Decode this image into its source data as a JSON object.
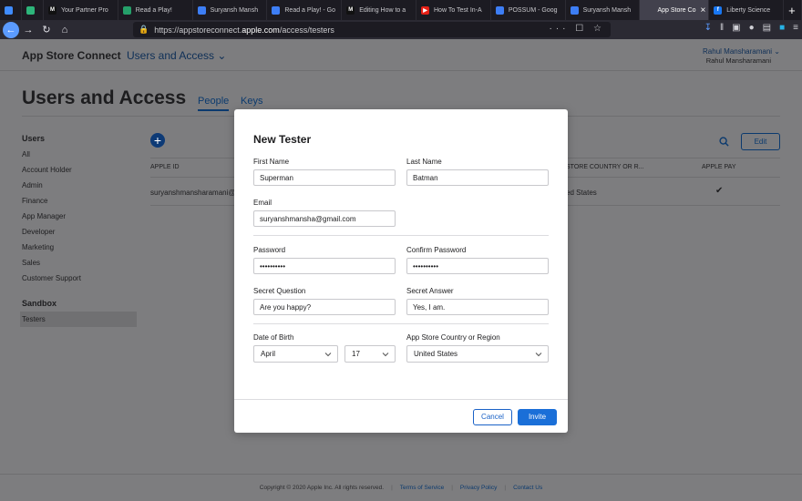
{
  "browser": {
    "tabs": [
      {
        "title": "",
        "icon": "infinity-icon",
        "color": "#3f8cff"
      },
      {
        "title": "",
        "icon": "shield-icon",
        "color": "#2db57a"
      },
      {
        "title": "Your Partner Pro",
        "icon": "medium-icon",
        "color": "#111111",
        "glyph": "M"
      },
      {
        "title": "Read a Play!",
        "icon": "image-icon",
        "color": "#25a06a",
        "glyph": ""
      },
      {
        "title": "Suryansh Mansh",
        "icon": "doc-icon",
        "color": "#3d7ef5",
        "glyph": ""
      },
      {
        "title": "Read a Play! - Go",
        "icon": "doc-icon",
        "color": "#3d7ef5",
        "glyph": ""
      },
      {
        "title": "Editing How to a",
        "icon": "medium-icon",
        "color": "#111111",
        "glyph": "M"
      },
      {
        "title": "How To Test In-A",
        "icon": "youtube-icon",
        "color": "#e62117",
        "glyph": "▶"
      },
      {
        "title": "POSSUM - Goog",
        "icon": "doc-icon",
        "color": "#3d7ef5",
        "glyph": ""
      },
      {
        "title": "Suryansh Mansh",
        "icon": "doc-icon",
        "color": "#3d7ef5",
        "glyph": ""
      },
      {
        "title": "App Store Co",
        "icon": "apple-icon",
        "color": "#42414d",
        "glyph": "",
        "active": true
      },
      {
        "title": "Liberty Science",
        "icon": "facebook-icon",
        "color": "#1877f2",
        "glyph": "f"
      }
    ],
    "url_prefix": "https://appstoreconnect.",
    "url_host": "apple.com",
    "url_path": "/access/testers",
    "url_right": "··· ☐ ☆"
  },
  "header": {
    "app_title": "App Store Connect",
    "section": "Users and Access ⌄",
    "user_name": "Rahul Mansharamani ⌄",
    "user_sub": "Rahul Mansharamani"
  },
  "page": {
    "title": "Users and Access",
    "tab_people": "People",
    "tab_keys": "Keys"
  },
  "sidebar": {
    "users_heading": "Users",
    "users_items": [
      "All",
      "Account Holder",
      "Admin",
      "Finance",
      "App Manager",
      "Developer",
      "Marketing",
      "Sales",
      "Customer Support"
    ],
    "sandbox_heading": "Sandbox",
    "sandbox_items": [
      "Testers"
    ]
  },
  "table": {
    "add_label": "+",
    "edit_label": "Edit",
    "col_apple_id": "APPLE ID",
    "col_store": "STORE COUNTRY OR R...",
    "col_pay": "APPLE PAY",
    "row_apple_id": "suryanshmansharamani@",
    "row_store": "ed States",
    "row_pay": "✔"
  },
  "modal": {
    "title": "New Tester",
    "first_name_label": "First Name",
    "first_name_value": "Superman",
    "last_name_label": "Last Name",
    "last_name_value": "Batman",
    "email_label": "Email",
    "email_value": "suryanshmansha@gmail.com",
    "password_label": "Password",
    "password_value": "••••••••••",
    "confirm_label": "Confirm Password",
    "confirm_value": "••••••••••",
    "question_label": "Secret Question",
    "question_value": "Are you happy?",
    "answer_label": "Secret Answer",
    "answer_value": "Yes, I am.",
    "dob_label": "Date of Birth",
    "dob_month": "April",
    "dob_day": "17",
    "country_label": "App Store Country or Region",
    "country_value": "United States",
    "cancel_label": "Cancel",
    "invite_label": "Invite"
  },
  "footer": {
    "copyright": "Copyright © 2020 Apple Inc. All rights reserved.",
    "terms": "Terms of Service",
    "privacy": "Privacy Policy",
    "contact": "Contact Us"
  },
  "colors": {
    "overlay": "#7d7d7f",
    "primary": "#1a6fd8",
    "nav_blue": "#0b3a6e"
  }
}
